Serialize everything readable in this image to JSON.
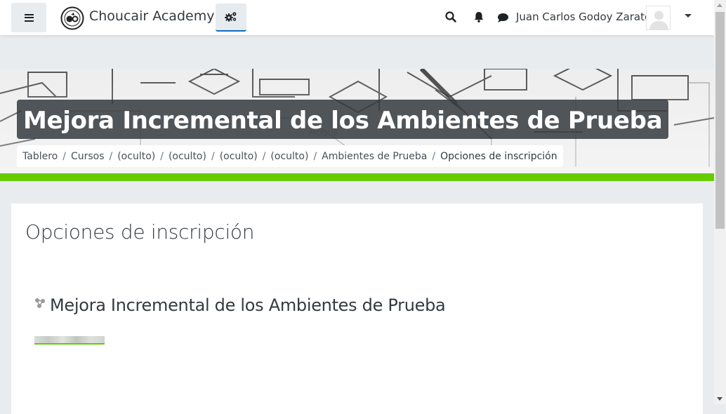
{
  "navbar": {
    "brand_name": "Choucair Academy",
    "user_name": "Juan Carlos Godoy Zarate",
    "icons": {
      "menu": "hamburger-icon",
      "admin": "cogs-icon",
      "search": "search-icon",
      "notifications": "bell-icon",
      "messages": "comment-icon",
      "user_menu": "chevron-down-icon"
    }
  },
  "header": {
    "course_title": "Mejora Incremental de los Ambientes de Prueba",
    "breadcrumb": [
      "Tablero",
      "Cursos",
      "(oculto)",
      "(oculto)",
      "(oculto)",
      "(oculto)",
      "Ambientes de Prueba",
      "Opciones de inscripción"
    ],
    "accent_color": "#66cc00"
  },
  "main": {
    "page_heading": "Opciones de inscripción",
    "course": {
      "name": "Mejora Incremental de los Ambientes de Prueba",
      "icon": "course-icon"
    }
  }
}
